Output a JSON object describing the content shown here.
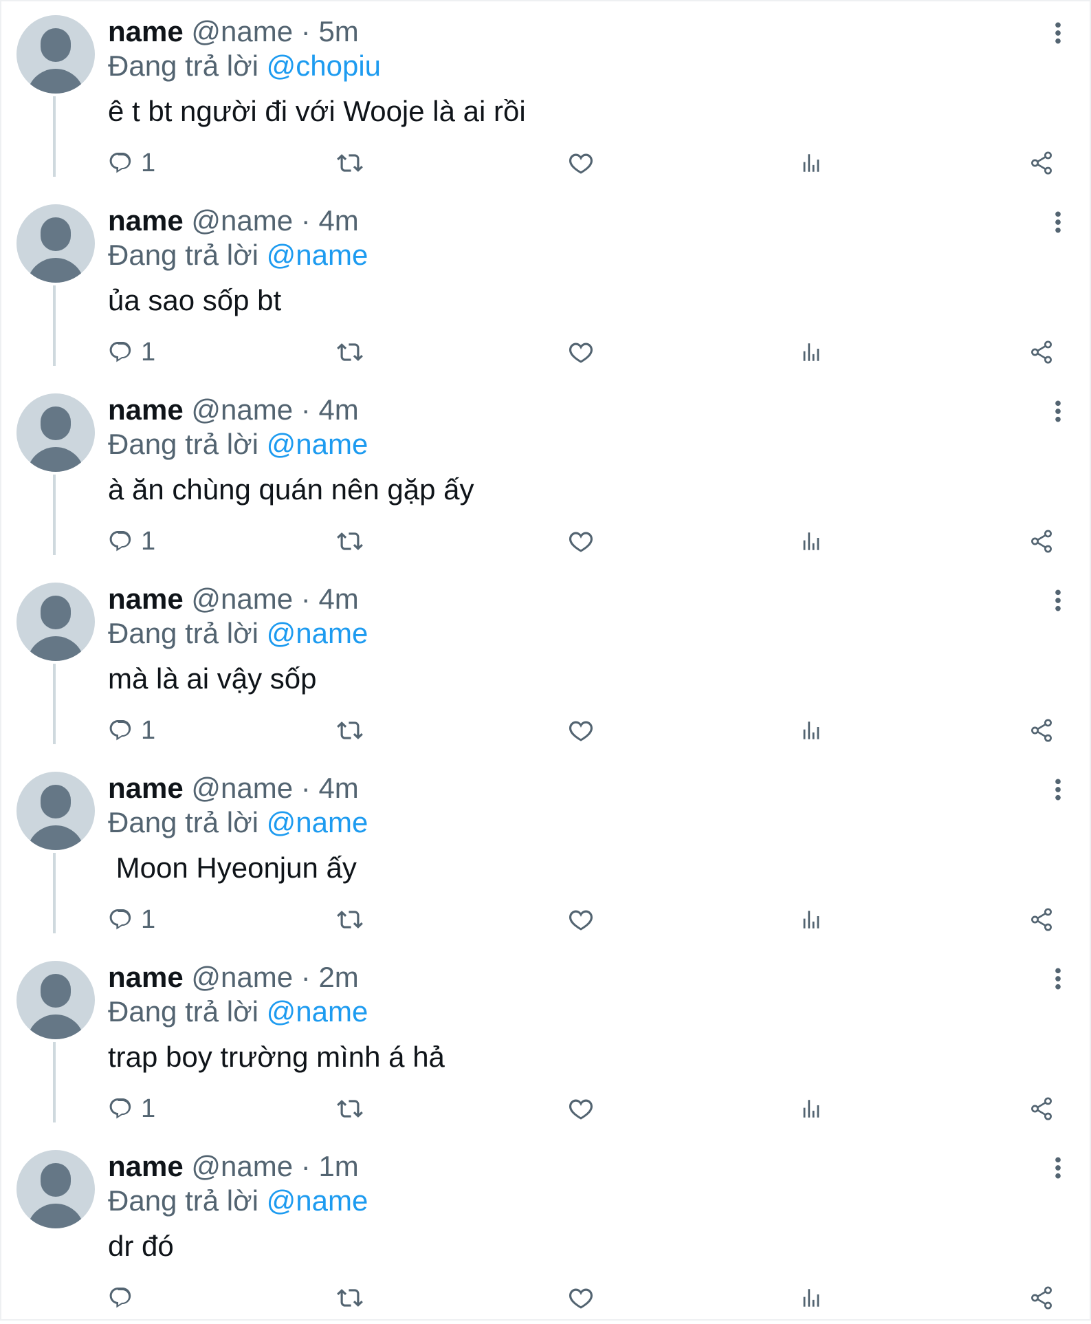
{
  "thread": {
    "tweets": [
      {
        "name": "name",
        "handle": "@name",
        "sep": "·",
        "time": "5m",
        "reply_prefix": "Đang trả lời",
        "reply_to": "@chopiu",
        "text": "ê t bt người đi với Wooje là ai rồi",
        "reply_count": "1"
      },
      {
        "name": "name",
        "handle": "@name",
        "sep": "·",
        "time": "4m",
        "reply_prefix": "Đang trả lời",
        "reply_to": "@name",
        "text": "ủa sao sốp bt",
        "reply_count": "1"
      },
      {
        "name": "name",
        "handle": "@name",
        "sep": "·",
        "time": "4m",
        "reply_prefix": "Đang trả lời",
        "reply_to": "@name",
        "text": "à ăn chùng quán nên gặp ấy",
        "reply_count": "1"
      },
      {
        "name": "name",
        "handle": "@name",
        "sep": "·",
        "time": "4m",
        "reply_prefix": "Đang trả lời",
        "reply_to": "@name",
        "text": "mà là ai vậy sốp",
        "reply_count": "1"
      },
      {
        "name": "name",
        "handle": "@name",
        "sep": "·",
        "time": "4m",
        "reply_prefix": "Đang trả lời",
        "reply_to": "@name",
        "text": " Moon Hyeonjun ấy",
        "reply_count": "1"
      },
      {
        "name": "name",
        "handle": "@name",
        "sep": "·",
        "time": "2m",
        "reply_prefix": "Đang trả lời",
        "reply_to": "@name",
        "text": "trap boy trường mình á hả",
        "reply_count": "1"
      },
      {
        "name": "name",
        "handle": "@name",
        "sep": "·",
        "time": "1m",
        "reply_prefix": "Đang trả lời",
        "reply_to": "@name",
        "text": "dr đó",
        "reply_count": ""
      }
    ]
  },
  "icons": {
    "reply": "reply-icon",
    "retweet": "retweet-icon",
    "like": "heart-icon",
    "views": "views-chart-icon",
    "share": "share-icon",
    "more": "more-vertical-icon"
  },
  "colors": {
    "text": "#0f1419",
    "muted": "#536471",
    "link": "#1d9bf0",
    "avatar_bg": "#ccd6dd",
    "avatar_fg": "#657786",
    "thread_line": "#cfd9de"
  }
}
